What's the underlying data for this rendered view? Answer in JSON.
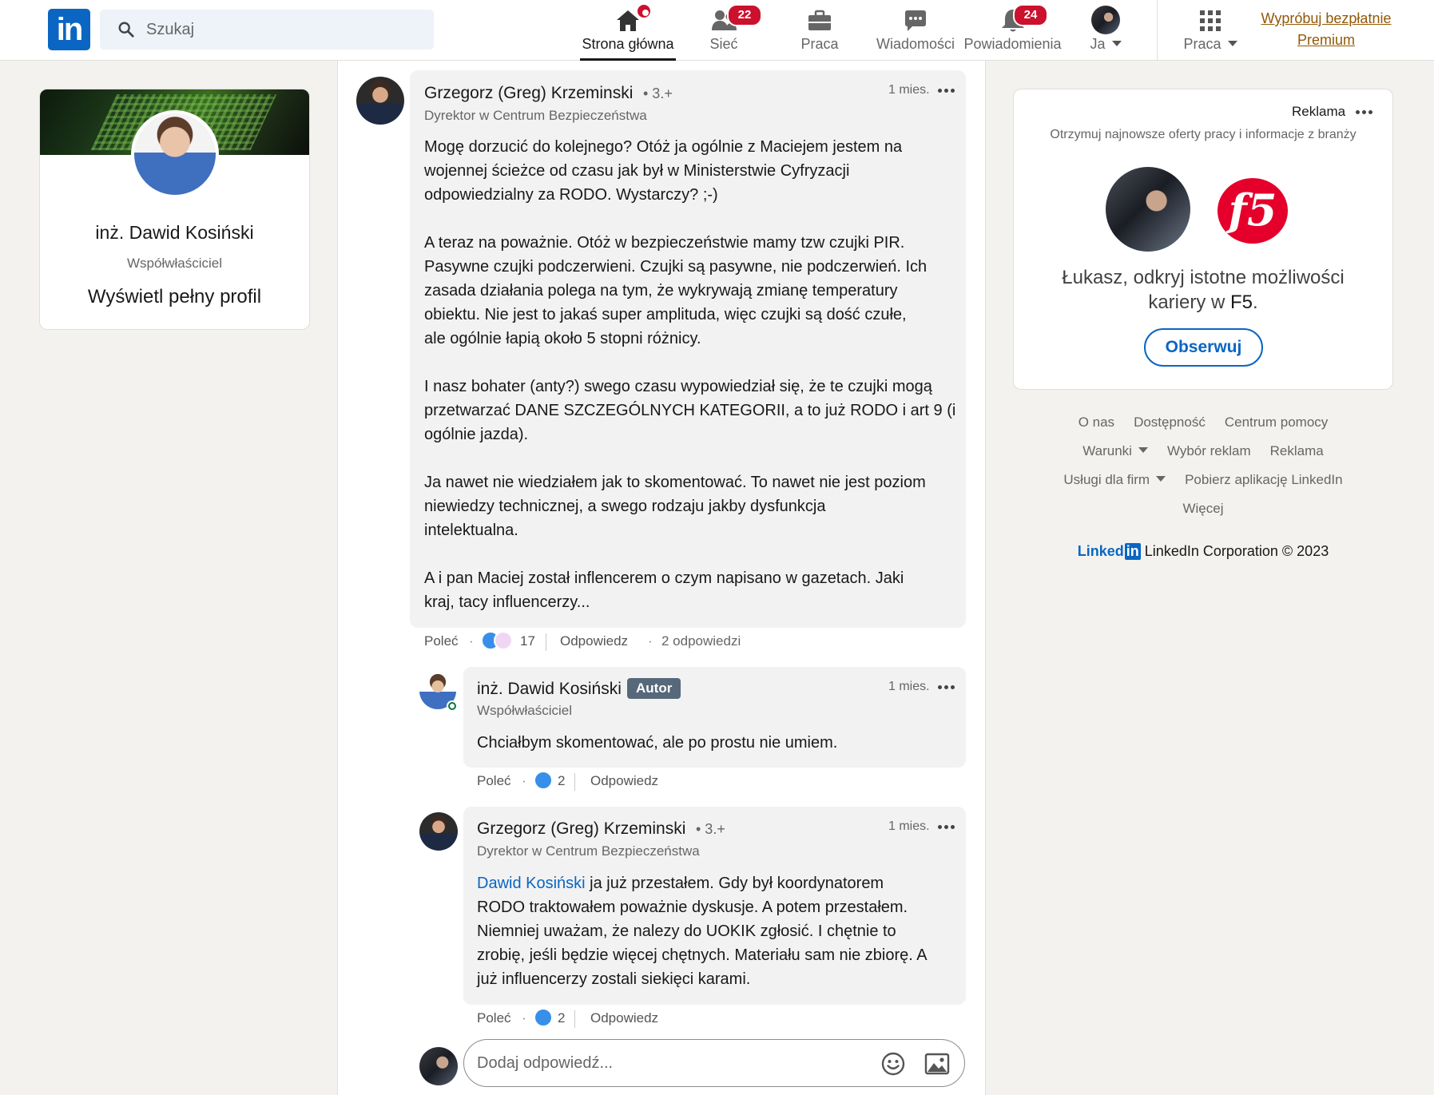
{
  "nav": {
    "search_placeholder": "Szukaj",
    "items": [
      {
        "label": "Strona główna",
        "icon": "home-icon",
        "active": true
      },
      {
        "label": "Sieć",
        "icon": "network-icon",
        "badge": "22"
      },
      {
        "label": "Praca",
        "icon": "briefcase-icon"
      },
      {
        "label": "Wiadomości",
        "icon": "messaging-icon"
      },
      {
        "label": "Powiadomienia",
        "icon": "bell-icon",
        "badge": "24"
      },
      {
        "label": "Ja",
        "icon": "avatar"
      },
      {
        "label": "Praca",
        "icon": "grid-icon"
      }
    ],
    "premium_line1": "Wypróbuj bezpłatnie",
    "premium_line2": "Premium"
  },
  "profile": {
    "name": "inż. Dawid Kosiński",
    "headline": "Współwłaściciel",
    "full_profile": "Wyświetl pełny profil"
  },
  "comments": [
    {
      "author": "Grzegorz (Greg) Krzeminski",
      "degree": "• 3.+",
      "headline": "Dyrektor w Centrum Bezpieczeństwa",
      "time": "1 mies.",
      "text": "Mogę dorzucić do kolejnego? Otóż ja ogólnie z Maciejem jestem na\nwojennej ścieżce od czasu jak był w Ministerstwie Cyfryzacji\nodpowiedzialny za RODO. Wystarczy? ;-)\n\nA teraz na poważnie. Otóż w bezpieczeństwie mamy tzw czujki PIR.\nPasywne czujki podczerwieni. Czujki są pasywne, nie podczerwień. Ich\nzasada działania polega na tym, że wykrywają zmianę temperatury\nobiektu. Nie jest to jakaś super amplituda, więc czujki są dość czułe,\nale ogólnie łapią około 5 stopni różnicy.\n\nI nasz bohater (anty?) swego czasu wypowiedział się, że te czujki mogą\nprzetwarzać DANE SZCZEGÓLNYCH KATEGORII, a to już RODO i art 9 (i\nogólnie jazda).\n\nJa nawet nie wiedziałem jak to skomentować. To nawet nie jest poziom\nniewiedzy technicznej, a swego rodzaju jakby dysfunkcja\nintelektualna.\n\nA i pan Maciej został inflencerem o czym napisano w gazetach. Jaki\nkraj, tacy influencerzy...",
      "like": "Poleć",
      "reactions": "17",
      "reply": "Odpowiedz",
      "replies_count": "2 odpowiedzi"
    },
    {
      "author": "inż. Dawid Kosiński",
      "badge": "Autor",
      "headline": "Współwłaściciel",
      "time": "1 mies.",
      "text": "Chciałbym skomentować, ale po prostu nie umiem.",
      "like": "Poleć",
      "reactions": "2",
      "reply": "Odpowiedz"
    },
    {
      "author": "Grzegorz (Greg) Krzeminski",
      "degree": "• 3.+",
      "headline": "Dyrektor w Centrum Bezpieczeństwa",
      "time": "1 mies.",
      "mention": "Dawid Kosiński",
      "text": " ja już przestałem. Gdy był koordynatorem\nRODO traktowałem poważnie dyskusje. A potem przestałem.\nNiemniej uważam, że nalezy do UOKIK zgłosić. I chętnie to\nzrobię, jeśli będzie więcej chętnych. Materiału sam nie zbiorę. A\njuż influencerzy zostali siekięci karami.",
      "like": "Poleć",
      "reactions": "2",
      "reply": "Odpowiedz"
    }
  ],
  "reply_placeholder": "Dodaj odpowiedź...",
  "ad": {
    "label": "Reklama",
    "subtitle": "Otrzymuj najnowsze oferty pracy i informacje z branży",
    "logo_text": "f5",
    "text_prefix": "Łukasz, odkryj istotne możliwości kariery w ",
    "text_company": "F5",
    "text_suffix": ".",
    "button": "Obserwuj"
  },
  "footer": {
    "links": [
      "O nas",
      "Dostępność",
      "Centrum pomocy",
      "Warunki",
      "Wybór reklam",
      "Reklama",
      "Usługi dla firm",
      "Pobierz aplikację LinkedIn",
      "Więcej"
    ],
    "logo_word": "Linked",
    "logo_in": "in",
    "copyright": "LinkedIn Corporation © 2023"
  },
  "colors": {
    "brand": "#0a66c2",
    "badge": "#cb112d",
    "premium": "#915907",
    "background": "#f4f2ee"
  }
}
